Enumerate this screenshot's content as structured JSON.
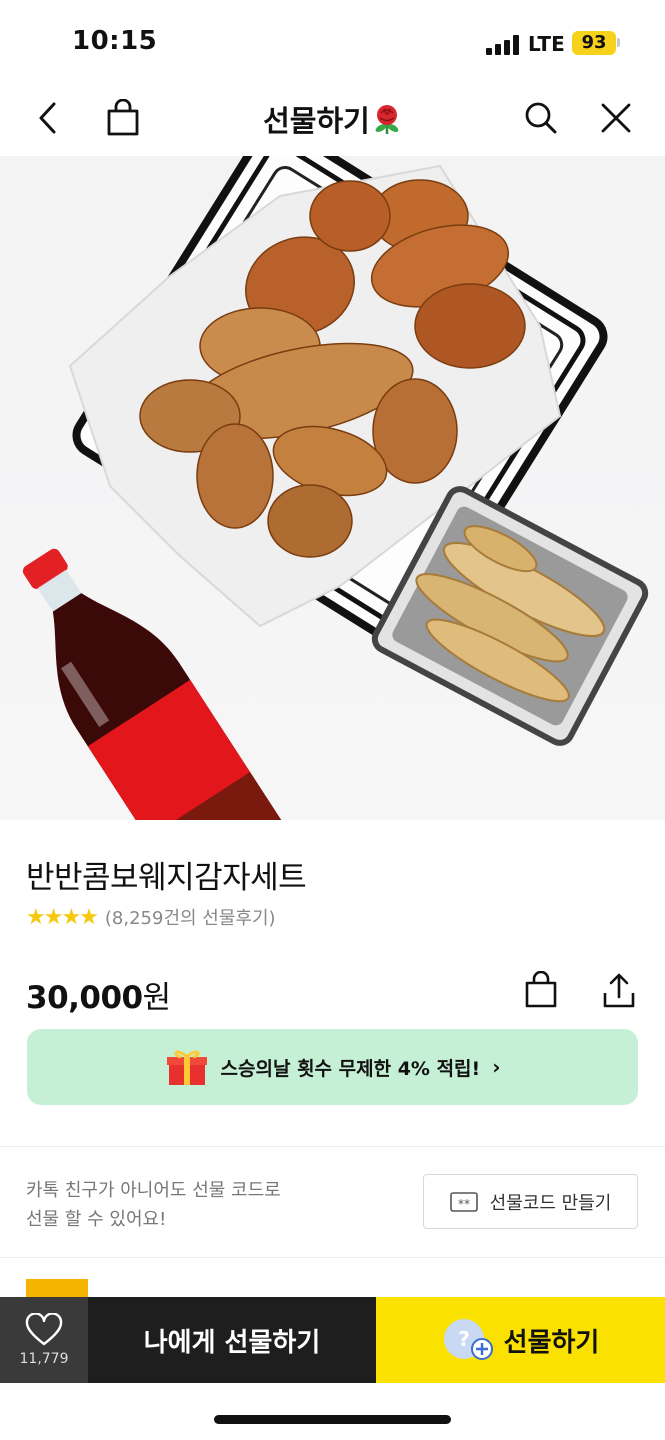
{
  "status": {
    "time": "10:15",
    "network": "LTE",
    "battery": "93"
  },
  "nav": {
    "title": "선물하기",
    "icons": [
      "back-icon",
      "shopping-bag-icon",
      "rose-icon",
      "search-icon",
      "close-icon"
    ]
  },
  "product": {
    "name": "반반콤보웨지감자세트",
    "rating_stars": "★★★★",
    "review_text": "(8,259건의 선물후기)",
    "price_amount": "30,000",
    "price_unit": "원"
  },
  "promo": {
    "text": "스승의날 횟수 무제한 4% 적립!",
    "chevron": "›",
    "icon": "gift-box-icon"
  },
  "gift_code": {
    "line1": "카톡 친구가 아니어도 선물 코드로",
    "line2": "선물 할 수 있어요!",
    "button_label": "선물코드 만들기",
    "button_icon_text": "**"
  },
  "bottom_bar": {
    "like_count": "11,779",
    "self_gift_label": "나에게 선물하기",
    "gift_label": "선물하기"
  },
  "colors": {
    "kakao_yellow": "#fae100",
    "promo_green": "#c6f0d5",
    "star_yellow": "#f6c90e",
    "dark_bar": "#1e1e1e"
  }
}
